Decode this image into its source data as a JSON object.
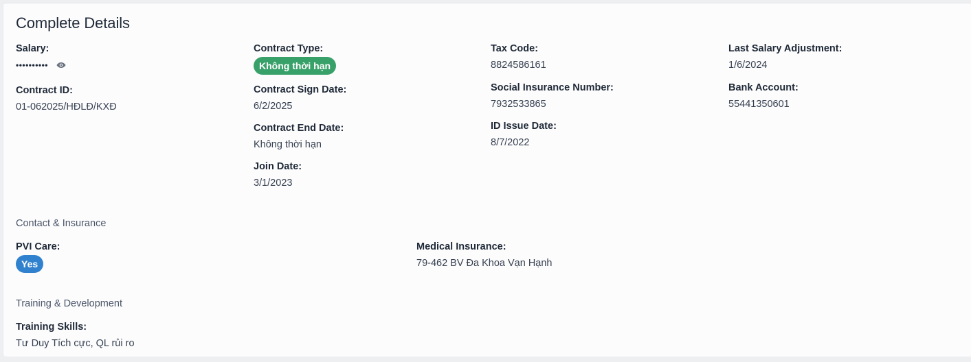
{
  "card": {
    "title": "Complete Details"
  },
  "details": {
    "salary": {
      "label": "Salary:",
      "value": "••••••••••"
    },
    "contract_id": {
      "label": "Contract ID:",
      "value": "01-062025/HĐLĐ/KXĐ"
    },
    "contract_type": {
      "label": "Contract Type:",
      "value": "Không thời hạn"
    },
    "contract_sign_date": {
      "label": "Contract Sign Date:",
      "value": "6/2/2025"
    },
    "contract_end_date": {
      "label": "Contract End Date:",
      "value": "Không thời hạn"
    },
    "join_date": {
      "label": "Join Date:",
      "value": "3/1/2023"
    },
    "tax_code": {
      "label": "Tax Code:",
      "value": "8824586161"
    },
    "social_insurance": {
      "label": "Social Insurance Number:",
      "value": "7932533865"
    },
    "id_issue_date": {
      "label": "ID Issue Date:",
      "value": "8/7/2022"
    },
    "last_salary_adjustment": {
      "label": "Last Salary Adjustment:",
      "value": "1/6/2024"
    },
    "bank_account": {
      "label": "Bank Account:",
      "value": "55441350601"
    }
  },
  "contact_insurance": {
    "title": "Contact & Insurance",
    "pvi_care": {
      "label": "PVI Care:",
      "value": "Yes"
    },
    "medical_insurance": {
      "label": "Medical Insurance:",
      "value": "79-462 BV Đa Khoa Vạn Hạnh"
    }
  },
  "training": {
    "title": "Training & Development",
    "skills": {
      "label": "Training Skills:",
      "value": "Tư Duy Tích cực, QL rủi ro"
    }
  },
  "colors": {
    "badge_green": "#38a169",
    "badge_blue": "#3182ce"
  },
  "icons": {
    "salary_toggle": "eye-icon"
  }
}
